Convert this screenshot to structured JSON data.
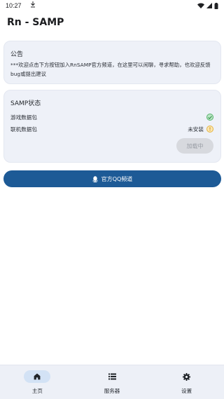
{
  "status_bar": {
    "time": "10:27",
    "download_icon": "download-icon",
    "wifi_icon": "wifi-icon",
    "signal_icon": "signal-icon",
    "battery_icon": "battery-icon"
  },
  "app": {
    "title": "Rn - SAMP"
  },
  "announcement": {
    "title": "公告",
    "text": "***欢迎点击下方按钮加入RnSAMP官方频道，在这里可以闲聊，寻求帮助，也欢迎反馈bug或提出建议"
  },
  "samp_status": {
    "title": "SAMP状态",
    "rows": [
      {
        "label": "游戏数据包",
        "state": "",
        "indicator": "check",
        "color": "#58b26b"
      },
      {
        "label": "联机数据包",
        "state": "未安装",
        "indicator": "warning",
        "color": "#e5b443"
      }
    ],
    "load_button": "加载中"
  },
  "channel_button": {
    "label": "官方QQ频道",
    "icon": "qq-icon",
    "color": "#1d5a96"
  },
  "bottom_nav": {
    "items": [
      {
        "label": "主页",
        "icon": "home-icon",
        "active": true
      },
      {
        "label": "服务器",
        "icon": "list-icon",
        "active": false
      },
      {
        "label": "设置",
        "icon": "gear-icon",
        "active": false
      }
    ]
  }
}
